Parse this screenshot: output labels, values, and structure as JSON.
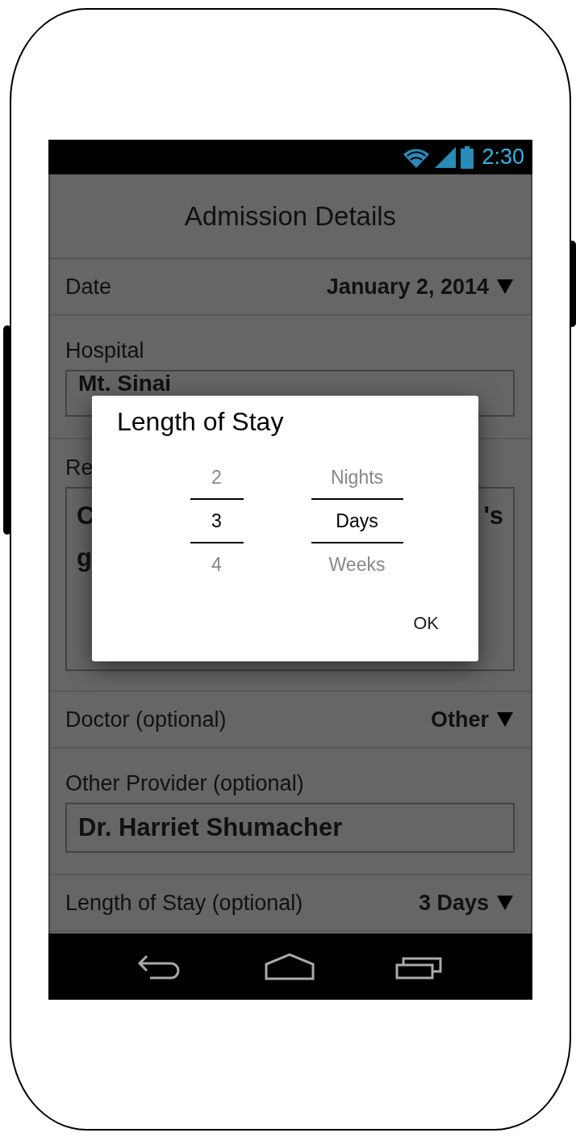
{
  "status_bar": {
    "time": "2:30"
  },
  "title": "Admission Details",
  "form": [
    {
      "kind": "dropdown",
      "label": "Date",
      "value": "January 2, 2014"
    },
    {
      "kind": "field",
      "label": "Hospital",
      "value": "Mt. Sinai"
    },
    {
      "kind": "area",
      "label": "Re",
      "lines": [
        {
          "left": "C",
          "right": "'s"
        },
        {
          "left": "g"
        }
      ]
    },
    {
      "kind": "dropdown",
      "label": "Doctor (optional)",
      "value": "Other"
    },
    {
      "kind": "field",
      "label": "Other Provider (optional)",
      "value": "Dr. Harriet Shumacher"
    },
    {
      "kind": "dropdown",
      "label": "Length of Stay (optional)",
      "value": "3 Days"
    }
  ],
  "dialog": {
    "title": "Length of Stay",
    "pickers": [
      {
        "items": [
          {
            "label": "2",
            "selected": false
          },
          {
            "label": "3",
            "selected": true
          },
          {
            "label": "4",
            "selected": false
          }
        ]
      },
      {
        "items": [
          {
            "label": "Nights",
            "selected": false
          },
          {
            "label": "Days",
            "selected": true
          },
          {
            "label": "Weeks",
            "selected": false
          }
        ]
      }
    ],
    "ok": "OK"
  }
}
